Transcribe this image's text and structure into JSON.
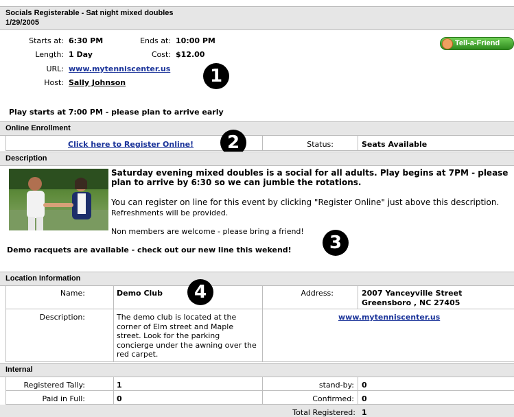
{
  "event": {
    "title": "Socials Registerable - Sat night mixed doubles",
    "date": "1/29/2005",
    "starts_label": "Starts at:",
    "starts_value": "6:30 PM",
    "ends_label": "Ends at:",
    "ends_value": "10:00 PM",
    "length_label": "Length:",
    "length_value": "1 Day",
    "cost_label": "Cost:",
    "cost_value": "$12.00",
    "url_label": "URL:",
    "url_value": "www.mytenniscenter.us",
    "host_label": "Host:",
    "host_value": "Sally Johnson",
    "note": "Play starts at 7:00 PM - please plan to arrive early",
    "tell_friend": "Tell-a-Friend"
  },
  "enrollment": {
    "header": "Online Enrollment",
    "register_link": "Click here to Register Online!",
    "status_label": "Status:",
    "status_value": "Seats Available"
  },
  "description": {
    "header": "Description",
    "lead": "Saturday evening mixed doubles is a social for all adults.  Play begins at 7PM - please plan to arrive by 6:30 so we can jumble the rotations.",
    "register_text": "You can register on line for this event by clicking \"Register Online\" just above this description.",
    "refreshments": "Refreshments will be provided.",
    "members": "Non members are welcome - please bring a friend!",
    "demo": "Demo racquets are available - check out our new line this wekend!"
  },
  "location": {
    "header": "Location Information",
    "name_label": "Name:",
    "name_value": "Demo Club",
    "address_label": "Address:",
    "address_line1": "2007 Yanceyville Street",
    "address_line2": "Greensboro , NC 27405",
    "desc_label": "Description:",
    "desc_value": "The demo club is located at the corner of Elm street and Maple street. Look for the parking concierge under the awning over the red carpet.",
    "website": "www.mytenniscenter.us"
  },
  "internal": {
    "header": "Internal",
    "registered_label": "Registered Tally:",
    "registered_value": "1",
    "standby_label": "stand-by:",
    "standby_value": "0",
    "paid_label": "Paid in Full:",
    "paid_value": "0",
    "confirmed_label": "Confirmed:",
    "confirmed_value": "0",
    "total_label": "Total Registered:",
    "total_value": "1"
  },
  "markers": [
    "1",
    "2",
    "3",
    "4"
  ],
  "colors": {
    "header_bg": "#e6e6e6",
    "border": "#bdbdbd",
    "link": "#1a3399",
    "tell_friend": "#3f9a2f"
  }
}
